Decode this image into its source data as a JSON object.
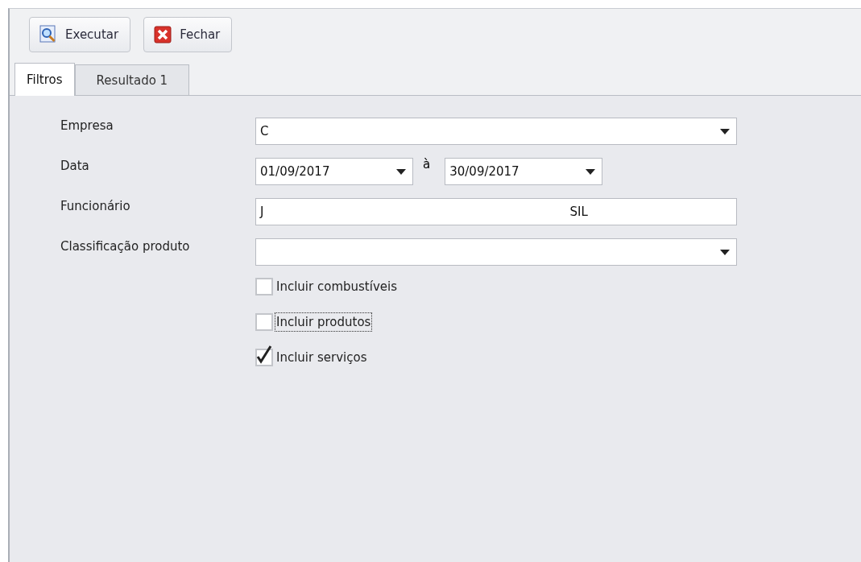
{
  "toolbar": [
    {
      "kind": "search",
      "label": "Executar"
    },
    {
      "kind": "close",
      "label": "Fechar"
    }
  ],
  "tabs": [
    {
      "label": "Filtros",
      "selected": true
    },
    {
      "label": "Resultado 1",
      "selected": false
    }
  ],
  "filters": [
    {
      "label": "Empresa",
      "kind": "combo",
      "value": "C"
    },
    {
      "label": "Data",
      "kind": "range",
      "from": "01/09/2017",
      "separator": "à",
      "to": "30/09/2017"
    },
    {
      "label": "Funcionário",
      "kind": "text",
      "value_parts": [
        "J",
        "SIL"
      ]
    },
    {
      "label": "Classificação produto",
      "kind": "combo"
    }
  ],
  "options": [
    {
      "label": "Incluir combustíveis",
      "checked": false,
      "focused": false
    },
    {
      "label": "Incluir produtos",
      "checked": false,
      "focused": true
    },
    {
      "label": "Incluir serviços",
      "checked": true,
      "focused": false
    }
  ]
}
